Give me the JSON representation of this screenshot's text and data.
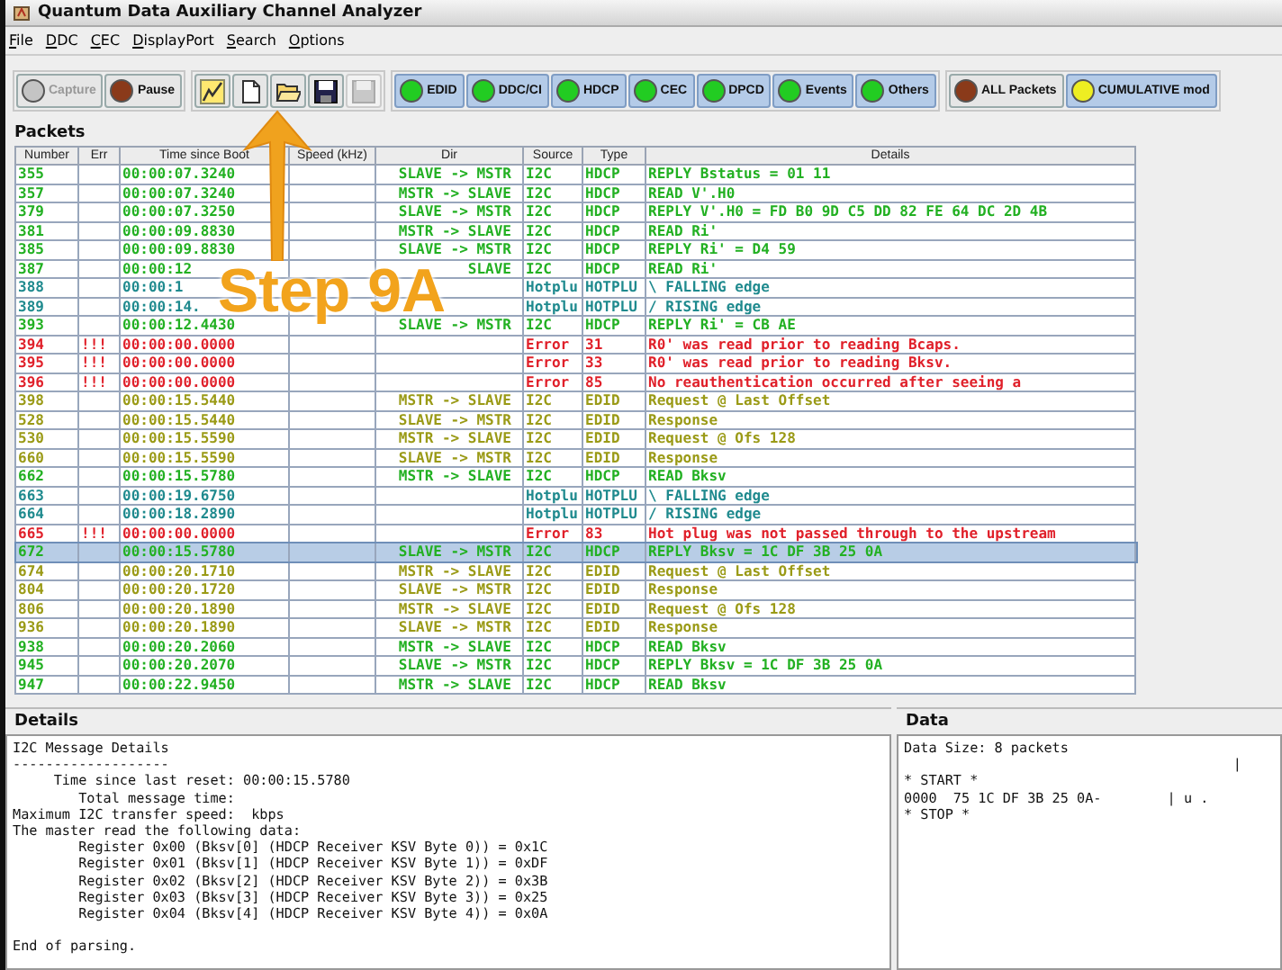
{
  "window": {
    "title": "Quantum Data Auxiliary Channel Analyzer"
  },
  "menu": [
    "File",
    "DDC",
    "CEC",
    "DisplayPort",
    "Search",
    "Options"
  ],
  "toolbar": {
    "capture_buttons": [
      {
        "label": "Capture",
        "disabled": true,
        "color": "#c4c4c4"
      },
      {
        "label": "Pause",
        "disabled": false,
        "color": "#8a3a1a"
      }
    ],
    "icon_buttons": [
      {
        "disabled": false
      },
      {
        "disabled": false
      },
      {
        "disabled": false
      },
      {
        "disabled": false
      },
      {
        "disabled": true
      }
    ],
    "filters": [
      {
        "label": "EDID",
        "color": "#22cc22"
      },
      {
        "label": "DDC/CI",
        "color": "#22cc22"
      },
      {
        "label": "HDCP",
        "color": "#22cc22"
      },
      {
        "label": "CEC",
        "color": "#22cc22"
      },
      {
        "label": "DPCD",
        "color": "#22cc22"
      },
      {
        "label": "Events",
        "color": "#22cc22"
      },
      {
        "label": "Others",
        "color": "#22cc22"
      }
    ],
    "modes": [
      {
        "label": "ALL Packets",
        "selected": false,
        "color": "#8a3a1a"
      },
      {
        "label": "CUMULATIVE mod",
        "selected": true,
        "color": "#eeee22"
      }
    ]
  },
  "packets": {
    "title": "Packets",
    "columns": [
      "Number",
      "Err",
      "Time since Boot",
      "Speed (kHz)",
      "Dir",
      "Source",
      "Type",
      "Details"
    ],
    "rows": [
      {
        "kind": "hdcp",
        "selected": false,
        "cells": [
          "355",
          "",
          "00:00:07.3240",
          "",
          "SLAVE -> MSTR",
          "I2C",
          "HDCP",
          "REPLY Bstatus = 01 11"
        ]
      },
      {
        "kind": "hdcp",
        "selected": false,
        "cells": [
          "357",
          "",
          "00:00:07.3240",
          "",
          "MSTR -> SLAVE",
          "I2C",
          "HDCP",
          "READ V'.H0"
        ]
      },
      {
        "kind": "hdcp",
        "selected": false,
        "cells": [
          "379",
          "",
          "00:00:07.3250",
          "",
          "SLAVE -> MSTR",
          "I2C",
          "HDCP",
          "REPLY V'.H0 = FD B0 9D C5 DD 82 FE 64 DC 2D 4B"
        ]
      },
      {
        "kind": "hdcp",
        "selected": false,
        "cells": [
          "381",
          "",
          "00:00:09.8830",
          "",
          "MSTR -> SLAVE",
          "I2C",
          "HDCP",
          "READ Ri'"
        ]
      },
      {
        "kind": "hdcp",
        "selected": false,
        "cells": [
          "385",
          "",
          "00:00:09.8830",
          "",
          "SLAVE -> MSTR",
          "I2C",
          "HDCP",
          "REPLY Ri' = D4 59"
        ]
      },
      {
        "kind": "hdcp",
        "selected": false,
        "cells": [
          "387",
          "",
          "00:00:12",
          "",
          "SLAVE",
          "I2C",
          "HDCP",
          "READ Ri'"
        ]
      },
      {
        "kind": "hotplug",
        "selected": false,
        "cells": [
          "388",
          "",
          "00:00:1",
          "",
          "",
          "Hotplu",
          "HOTPLU",
          "\\ FALLING edge"
        ]
      },
      {
        "kind": "hotplug",
        "selected": false,
        "cells": [
          "389",
          "",
          "00:00:14.",
          "",
          "",
          "Hotplu",
          "HOTPLU",
          "/ RISING edge"
        ]
      },
      {
        "kind": "hdcp",
        "selected": false,
        "cells": [
          "393",
          "",
          "00:00:12.4430",
          "",
          "SLAVE -> MSTR",
          "I2C",
          "HDCP",
          "REPLY Ri' = CB AE"
        ]
      },
      {
        "kind": "error",
        "selected": false,
        "cells": [
          "394",
          "!!!",
          "00:00:00.0000",
          "",
          "",
          "Error",
          "31",
          "R0' was read prior to reading Bcaps."
        ]
      },
      {
        "kind": "error",
        "selected": false,
        "cells": [
          "395",
          "!!!",
          "00:00:00.0000",
          "",
          "",
          "Error",
          "33",
          "R0' was read prior to reading Bksv."
        ]
      },
      {
        "kind": "error",
        "selected": false,
        "cells": [
          "396",
          "!!!",
          "00:00:00.0000",
          "",
          "",
          "Error",
          "85",
          "No reauthentication occurred after seeing a"
        ]
      },
      {
        "kind": "edid",
        "selected": false,
        "cells": [
          "398",
          "",
          "00:00:15.5440",
          "",
          "MSTR -> SLAVE",
          "I2C",
          "EDID",
          "Request @ Last Offset"
        ]
      },
      {
        "kind": "edid",
        "selected": false,
        "cells": [
          "528",
          "",
          "00:00:15.5440",
          "",
          "SLAVE -> MSTR",
          "I2C",
          "EDID",
          "Response"
        ]
      },
      {
        "kind": "edid",
        "selected": false,
        "cells": [
          "530",
          "",
          "00:00:15.5590",
          "",
          "MSTR -> SLAVE",
          "I2C",
          "EDID",
          "Request @ Ofs 128"
        ]
      },
      {
        "kind": "edid",
        "selected": false,
        "cells": [
          "660",
          "",
          "00:00:15.5590",
          "",
          "SLAVE -> MSTR",
          "I2C",
          "EDID",
          "Response"
        ]
      },
      {
        "kind": "hdcp",
        "selected": false,
        "cells": [
          "662",
          "",
          "00:00:15.5780",
          "",
          "MSTR -> SLAVE",
          "I2C",
          "HDCP",
          "READ Bksv"
        ]
      },
      {
        "kind": "hotplug",
        "selected": false,
        "cells": [
          "663",
          "",
          "00:00:19.6750",
          "",
          "",
          "Hotplu",
          "HOTPLU",
          "\\ FALLING edge"
        ]
      },
      {
        "kind": "hotplug",
        "selected": false,
        "cells": [
          "664",
          "",
          "00:00:18.2890",
          "",
          "",
          "Hotplu",
          "HOTPLU",
          "/ RISING edge"
        ]
      },
      {
        "kind": "error",
        "selected": false,
        "cells": [
          "665",
          "!!!",
          "00:00:00.0000",
          "",
          "",
          "Error",
          "83",
          "Hot plug was not passed through to the upstream"
        ]
      },
      {
        "kind": "hdcp",
        "selected": true,
        "cells": [
          "672",
          "",
          "00:00:15.5780",
          "",
          "SLAVE -> MSTR",
          "I2C",
          "HDCP",
          "REPLY Bksv = 1C DF 3B 25 0A"
        ]
      },
      {
        "kind": "edid",
        "selected": false,
        "cells": [
          "674",
          "",
          "00:00:20.1710",
          "",
          "MSTR -> SLAVE",
          "I2C",
          "EDID",
          "Request @ Last Offset"
        ]
      },
      {
        "kind": "edid",
        "selected": false,
        "cells": [
          "804",
          "",
          "00:00:20.1720",
          "",
          "SLAVE -> MSTR",
          "I2C",
          "EDID",
          "Response"
        ]
      },
      {
        "kind": "edid",
        "selected": false,
        "cells": [
          "806",
          "",
          "00:00:20.1890",
          "",
          "MSTR -> SLAVE",
          "I2C",
          "EDID",
          "Request @ Ofs 128"
        ]
      },
      {
        "kind": "edid",
        "selected": false,
        "cells": [
          "936",
          "",
          "00:00:20.1890",
          "",
          "SLAVE -> MSTR",
          "I2C",
          "EDID",
          "Response"
        ]
      },
      {
        "kind": "hdcp",
        "selected": false,
        "cells": [
          "938",
          "",
          "00:00:20.2060",
          "",
          "MSTR -> SLAVE",
          "I2C",
          "HDCP",
          "READ Bksv"
        ]
      },
      {
        "kind": "hdcp",
        "selected": false,
        "cells": [
          "945",
          "",
          "00:00:20.2070",
          "",
          "SLAVE -> MSTR",
          "I2C",
          "HDCP",
          "REPLY Bksv = 1C DF 3B 25 0A"
        ]
      },
      {
        "kind": "hdcp",
        "selected": false,
        "cells": [
          "947",
          "",
          "00:00:22.9450",
          "",
          "MSTR -> SLAVE",
          "I2C",
          "HDCP",
          "READ Bksv"
        ]
      }
    ]
  },
  "details": {
    "title": "Details",
    "lines": [
      "I2C Message Details",
      "-------------------",
      "     Time since last reset: 00:00:15.5780",
      "        Total message time:",
      "Maximum I2C transfer speed:  kbps",
      "The master read the following data:",
      "        Register 0x00 (Bksv[0] (HDCP Receiver KSV Byte 0)) = 0x1C",
      "        Register 0x01 (Bksv[1] (HDCP Receiver KSV Byte 1)) = 0xDF",
      "        Register 0x02 (Bksv[2] (HDCP Receiver KSV Byte 2)) = 0x3B",
      "        Register 0x03 (Bksv[3] (HDCP Receiver KSV Byte 3)) = 0x25",
      "        Register 0x04 (Bksv[4] (HDCP Receiver KSV Byte 4)) = 0x0A"
    ],
    "footer": "End of parsing."
  },
  "data": {
    "title": "Data",
    "lines": [
      "Data Size: 8 packets",
      "                                        |",
      "* START *",
      "0000  75 1C DF 3B 25 0A-        | u .",
      "* STOP *"
    ]
  },
  "callout": {
    "label": "Step 9A"
  }
}
